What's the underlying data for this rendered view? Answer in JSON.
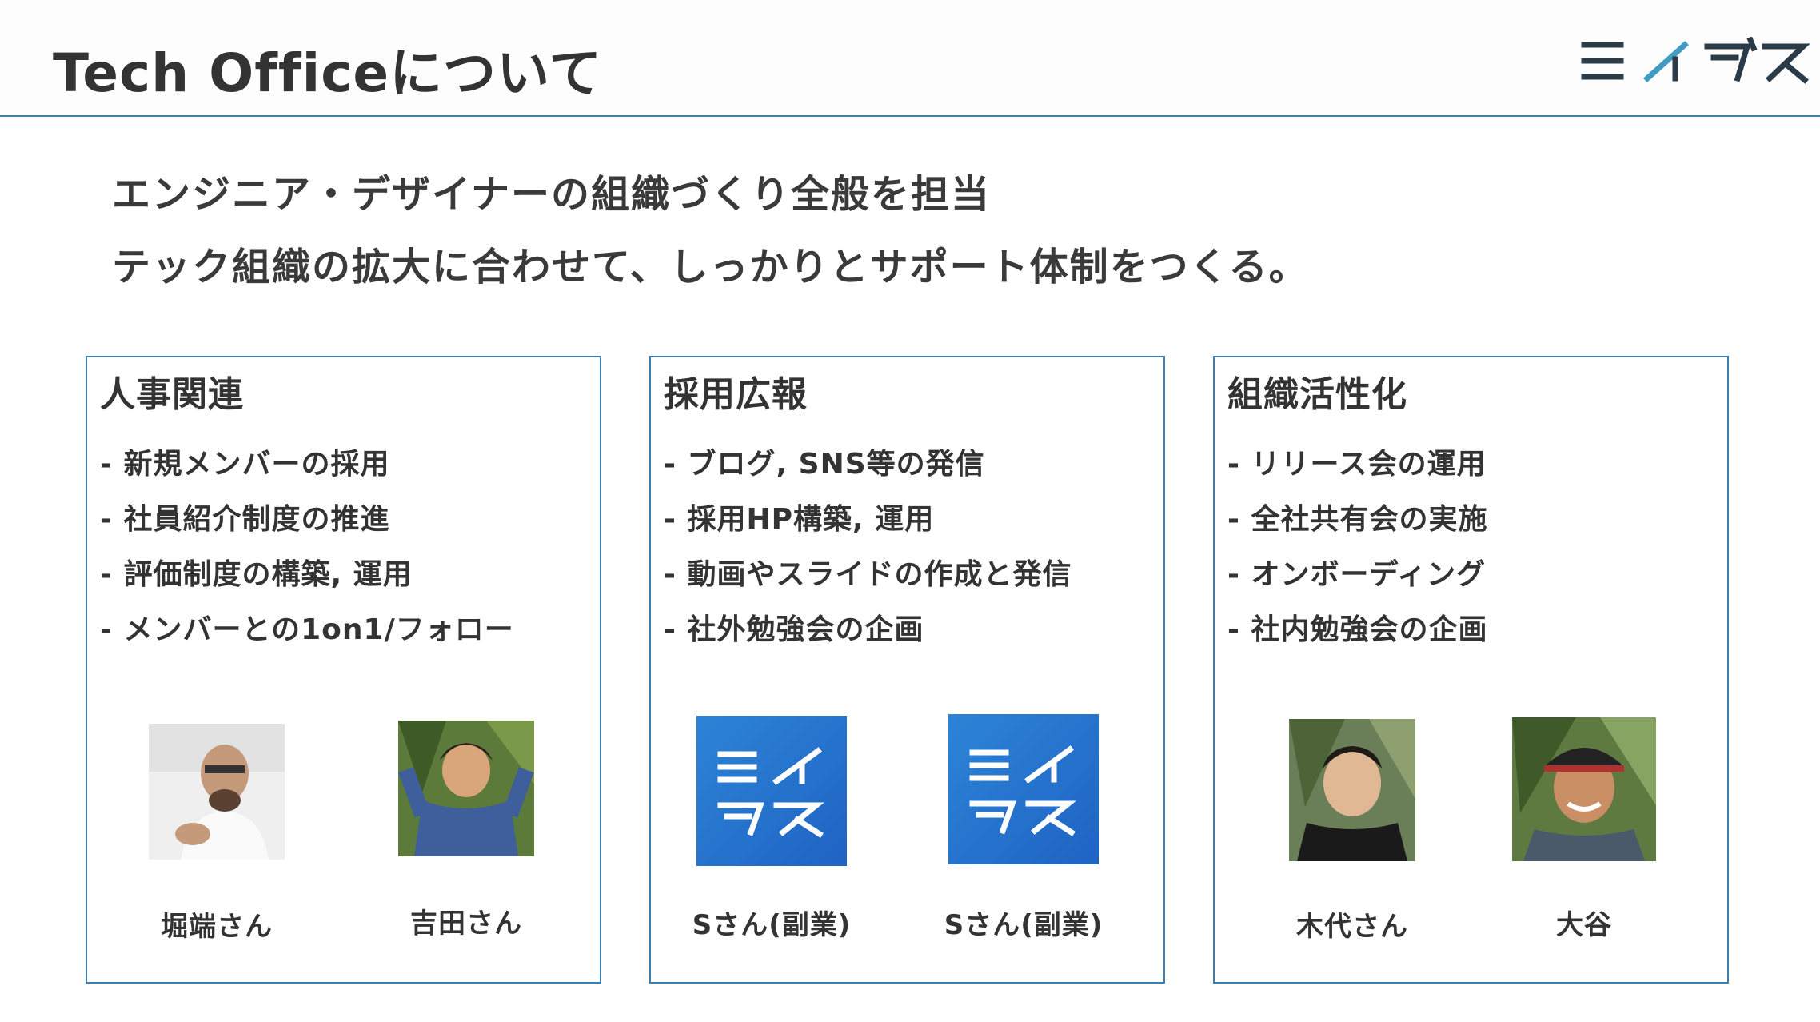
{
  "header": {
    "title": "Tech Officeについて",
    "logo_text": "ミイダス"
  },
  "lead": {
    "line1": "エンジニア・デザイナーの組織づくり全般を担当",
    "line2": "テック組織の拡大に合わせて、しっかりとサポート体制をつくる。"
  },
  "cards": [
    {
      "title": "人事関連",
      "items": [
        "- 新規メンバーの採用",
        "- 社員紹介制度の推進",
        "- 評価制度の構築, 運用",
        "- メンバーとの1on1/フォロー"
      ],
      "people": [
        {
          "name": "堀端さん",
          "image": "photo"
        },
        {
          "name": "吉田さん",
          "image": "photo"
        }
      ]
    },
    {
      "title": "採用広報",
      "items": [
        "- ブログ, SNS等の発信",
        "- 採用HP構築, 運用",
        "- 動画やスライドの作成と発信",
        "- 社外勉強会の企画"
      ],
      "people": [
        {
          "name": "Sさん(副業)",
          "image": "logo-tile"
        },
        {
          "name": "Sさん(副業)",
          "image": "logo-tile"
        }
      ]
    },
    {
      "title": "組織活性化",
      "items": [
        "- リリース会の運用",
        "- 全社共有会の実施",
        "- オンボーディング",
        "- 社内勉強会の企画"
      ],
      "people": [
        {
          "name": "木代さん",
          "image": "photo"
        },
        {
          "name": "大谷",
          "image": "photo"
        }
      ]
    }
  ],
  "colors": {
    "accent": "#3d7fb0",
    "tile_blue": "#2c84d6",
    "text": "#333333"
  }
}
